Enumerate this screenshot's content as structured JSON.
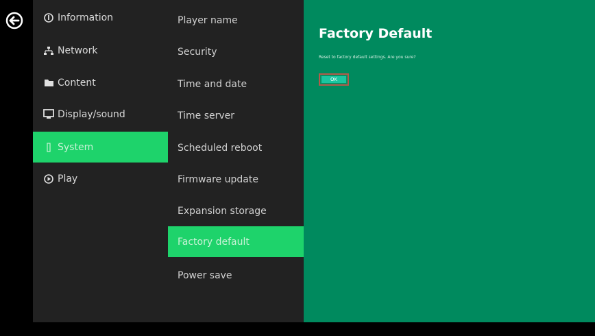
{
  "nav": {
    "back_icon": "back-arrow-circle-icon"
  },
  "menu": {
    "items": [
      {
        "label": "Information",
        "icon": "info-icon",
        "active": false
      },
      {
        "label": "Network",
        "icon": "network-icon",
        "active": false
      },
      {
        "label": "Content",
        "icon": "folder-icon",
        "active": false
      },
      {
        "label": "Display/sound",
        "icon": "monitor-icon",
        "active": false
      },
      {
        "label": "System",
        "icon": "system-icon",
        "active": true
      },
      {
        "label": "Play",
        "icon": "play-icon",
        "active": false
      }
    ]
  },
  "submenu": {
    "items": [
      {
        "label": "Player name",
        "active": false
      },
      {
        "label": "Security",
        "active": false
      },
      {
        "label": "Time and date",
        "active": false
      },
      {
        "label": "Time server",
        "active": false
      },
      {
        "label": "Scheduled reboot",
        "active": false
      },
      {
        "label": "Firmware update",
        "active": false
      },
      {
        "label": "Expansion storage",
        "active": false
      },
      {
        "label": "Factory default",
        "active": true
      },
      {
        "label": "Power save",
        "active": false
      }
    ]
  },
  "content": {
    "title": "Factory Default",
    "message": "Reset to factory default settings. Are you sure?",
    "ok_label": "OK"
  },
  "colors": {
    "sidebar_bg": "#222222",
    "active_item": "#1ed36b",
    "content_bg": "#008a5e",
    "ok_border": "#b45a4a"
  }
}
